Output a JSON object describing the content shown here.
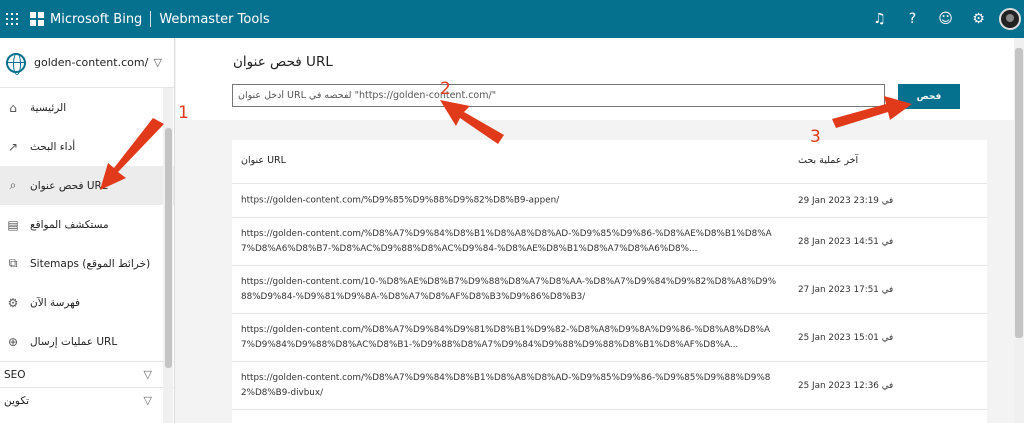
{
  "app": {
    "brand": "Microsoft Bing",
    "product": "Webmaster Tools"
  },
  "topbar": {
    "icons": [
      "notification-bell-icon",
      "help-icon",
      "feedback-smiley-icon",
      "settings-gear-icon"
    ],
    "glyphs": [
      "♫",
      "?",
      "☺",
      "⚙"
    ]
  },
  "sidebar": {
    "site": "golden-content.com/",
    "items": [
      {
        "label": "الرئيسية",
        "icon": "home-icon",
        "glyph": "⌂"
      },
      {
        "label": "أداء البحث",
        "icon": "trend-icon",
        "glyph": "↗"
      },
      {
        "label": "فحص عنوان URL",
        "icon": "search-icon",
        "glyph": "⌕"
      },
      {
        "label": "مستكشف المواقع",
        "icon": "site-explorer-icon",
        "glyph": "▤"
      },
      {
        "label": "Sitemaps (خرائط الموقع)",
        "icon": "sitemap-icon",
        "glyph": "⧉"
      },
      {
        "label": "فهرسة الآن",
        "icon": "indexnow-icon",
        "glyph": "⚙"
      },
      {
        "label": "عمليات إرسال URL",
        "icon": "globe-submit-icon",
        "glyph": "⊕"
      }
    ],
    "sections": [
      "SEO",
      "تكوين"
    ]
  },
  "main": {
    "title": "فحص عنوان URL",
    "input_placeholder": "أدخل عنوان URL لفحصه في \"https://golden-content.com/\"",
    "inspect_label": "فحص",
    "table": {
      "headers": {
        "url": "عنوان URL",
        "date": "آخر عملية بحث"
      },
      "rows": [
        {
          "url": "https://golden-content.com/%D9%85%D9%88%D9%82%D8%B9-appen/",
          "date": "29 Jan 2023 23:19 في"
        },
        {
          "url": "https://golden-content.com/%D8%A7%D9%84%D8%B1%D8%A8%D8%AD-%D9%85%D9%86-%D8%AE%D8%B1%D8%A7%D8%A6%D8%B7-%D8%AC%D9%88%D8%AC%D9%84-%D8%AE%D8%B1%D8%A7%D8%A6%D8%...",
          "date": "28 Jan 2023 14:51 في"
        },
        {
          "url": "https://golden-content.com/10-%D8%AE%D8%B7%D9%88%D8%A7%D8%AA-%D8%A7%D9%84%D9%82%D8%A8%D9%88%D9%84-%D9%81%D9%8A-%D8%A7%D8%AF%D8%B3%D9%86%D8%B3/",
          "date": "27 Jan 2023 17:51 في"
        },
        {
          "url": "https://golden-content.com/%D8%A7%D9%84%D9%81%D8%B1%D9%82-%D8%A8%D9%8A%D9%86-%D8%A8%D8%A7%D9%84%D9%88%D8%AC%D8%B1-%D9%88%D8%A7%D9%84%D9%88%D9%88%D8%B1%D8%AF%D8%A...",
          "date": "25 Jan 2023 15:01 في"
        },
        {
          "url": "https://golden-content.com/%D8%A7%D9%84%D8%B1%D8%A8%D8%AD-%D9%85%D9%86-%D9%85%D9%88%D9%82%D8%B9-divbux/",
          "date": "25 Jan 2023 12:36 في"
        }
      ]
    }
  },
  "annotations": {
    "color": "#e03a1a",
    "numbers": [
      "1",
      "2",
      "3"
    ]
  },
  "colors": {
    "brand": "#06708f",
    "annotation": "#e03a1a"
  }
}
